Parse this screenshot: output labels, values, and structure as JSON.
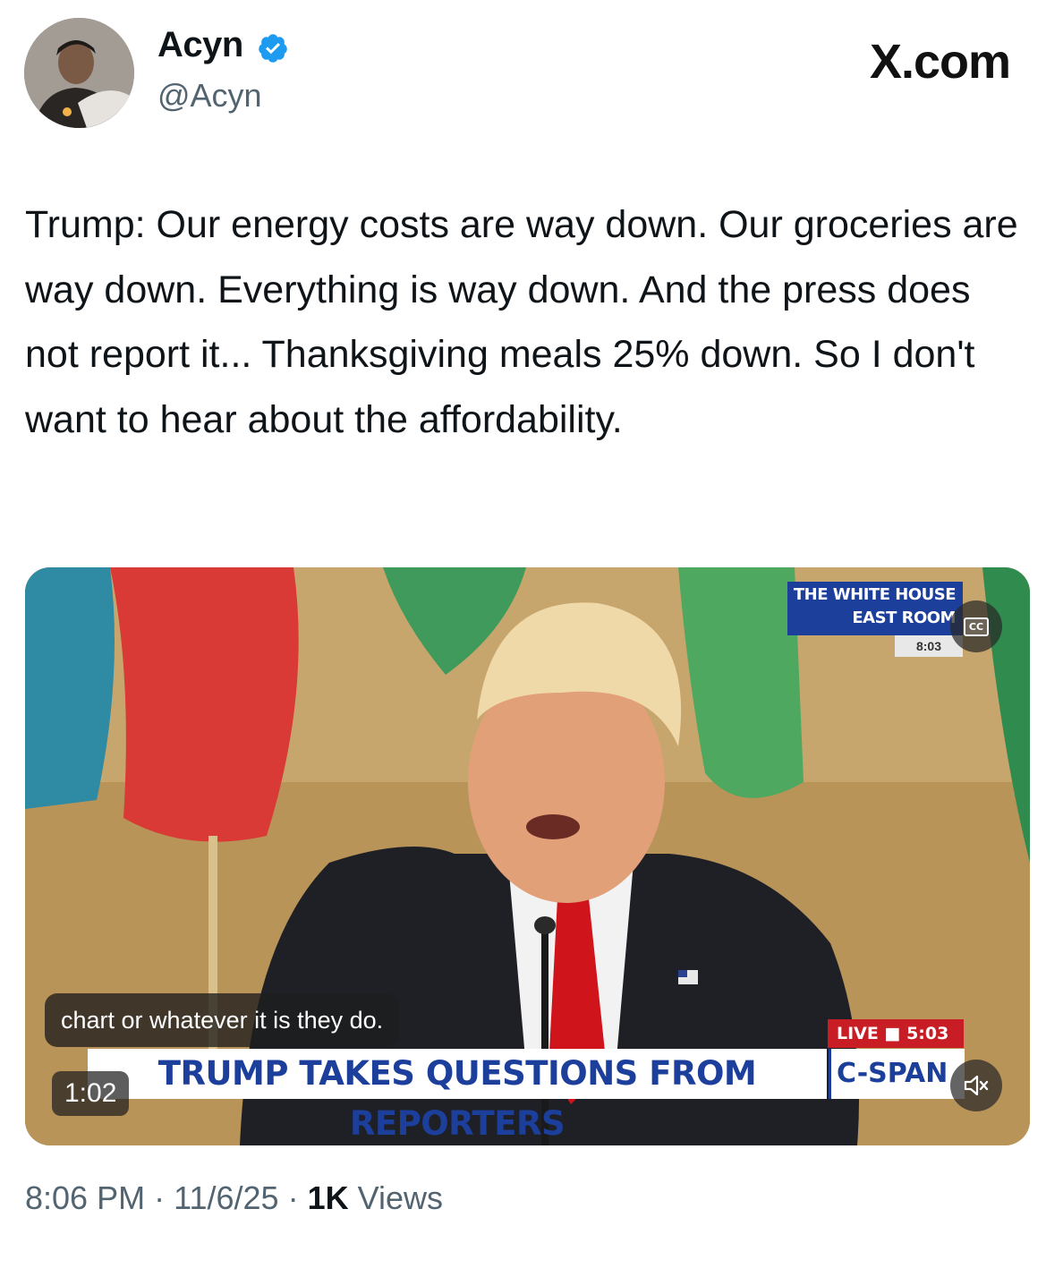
{
  "author": {
    "name": "Acyn",
    "handle": "@Acyn",
    "verified": true,
    "avatar_icon": "profile-photo"
  },
  "brand": "X.com",
  "tweet": {
    "text": "Trump: Our energy costs are way down. Our groceries are way down. Everything is way down. And the press does not report it... Thanksgiving meals 25% down. So I don't want to hear about the affordability."
  },
  "video": {
    "location_line1": "THE WHITE HOUSE",
    "location_line2": "EAST ROOM",
    "location_time": "8:03",
    "cc_label": "CC",
    "caption": "chart or whatever it is they do.",
    "live_label": "LIVE",
    "live_time": "5:03",
    "headline": "TRUMP TAKES QUESTIONS FROM REPORTERS",
    "network": "C-SPAN",
    "duration": "1:02",
    "muted_icon": "speaker-muted-icon"
  },
  "meta": {
    "time": "8:06 PM",
    "separator": "·",
    "date": "11/6/25",
    "views_count": "1K",
    "views_label": "Views"
  },
  "colors": {
    "verified_blue": "#1d9bf0",
    "secondary_text": "#536471",
    "cspan_blue": "#1d3f9c",
    "live_red": "#c81d25"
  }
}
